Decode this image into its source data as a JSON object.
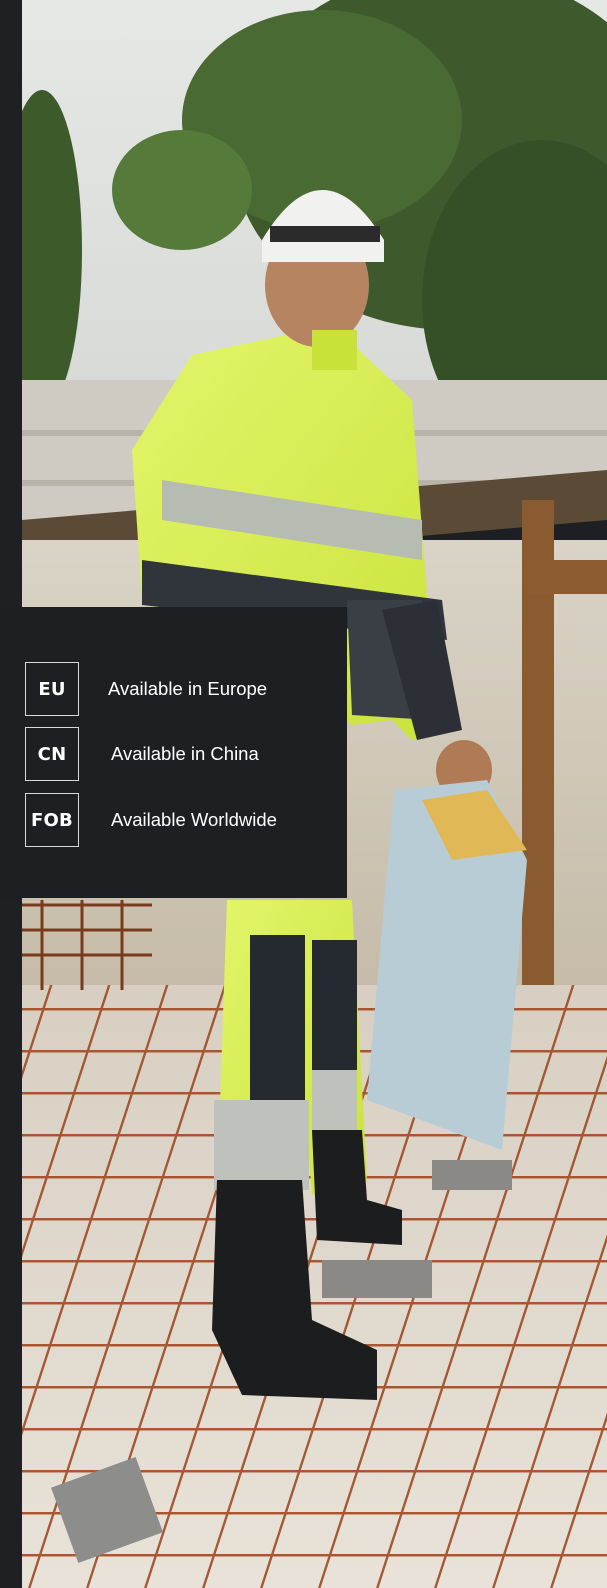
{
  "availability": {
    "items": [
      {
        "code": "EU",
        "label": "Available in Europe"
      },
      {
        "code": "CN",
        "label": "Available in China"
      },
      {
        "code": "FOB",
        "label": "Available Worldwide"
      }
    ]
  },
  "colors": {
    "panel_bg": "#1e1f23",
    "strip_bg": "#1f2024",
    "text": "#ffffff",
    "box_border": "#d9d9d9"
  }
}
